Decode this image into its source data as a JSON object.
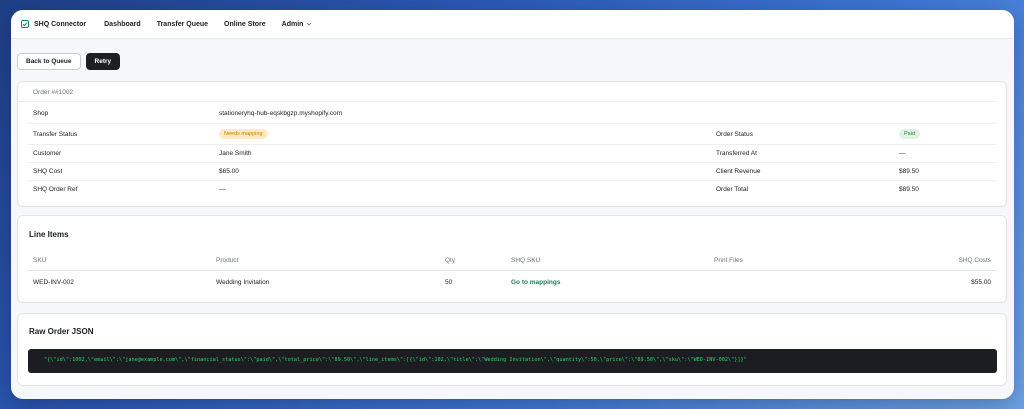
{
  "nav": {
    "brand": "SHQ Connector",
    "items": [
      "Dashboard",
      "Transfer Queue",
      "Online Store"
    ],
    "admin": "Admin"
  },
  "actions": {
    "back": "Back to Queue",
    "retry": "Retry"
  },
  "order": {
    "heading": "Order ##1002",
    "shop_label": "Shop",
    "shop_value": "stationeryhq-hub-eqskbgzp.myshopify.com",
    "transfer_status_label": "Transfer Status",
    "transfer_status_value": "Needs mapping",
    "order_status_label": "Order Status",
    "order_status_value": "Paid",
    "customer_label": "Customer",
    "customer_value": "Jane Smith",
    "transferred_at_label": "Transferred At",
    "transferred_at_value": "—",
    "shq_cost_label": "SHQ Cost",
    "shq_cost_value": "$65.00",
    "client_revenue_label": "Client Revenue",
    "client_revenue_value": "$89.50",
    "shq_order_ref_label": "SHQ Order Ref",
    "shq_order_ref_value": "—",
    "order_total_label": "Order Total",
    "order_total_value": "$89.50"
  },
  "line_items": {
    "title": "Line Items",
    "columns": [
      "SKU",
      "Product",
      "Qty",
      "SHQ SKU",
      "Print Files",
      "SHQ Costs"
    ],
    "rows": [
      {
        "sku": "WED-INV-002",
        "product": "Wedding Invitation",
        "qty": "50",
        "shq_sku": "Go to mappings",
        "print_files": "",
        "shq_costs": "$55.00"
      }
    ]
  },
  "raw": {
    "title": "Raw Order JSON",
    "json": "\"{\\\"id\\\":1002,\\\"email\\\":\\\"jane@example.com\\\",\\\"financial_status\\\":\\\"paid\\\",\\\"total_price\\\":\\\"89.50\\\",\\\"line_items\\\":[{\\\"id\\\":102,\\\"title\\\":\\\"Wedding Invitation\\\",\\\"quantity\\\":50,\\\"price\\\":\\\"89.50\\\",\\\"sku\\\":\\\"WED-INV-002\\\"}]}\""
  },
  "colors": {
    "primary_button": "#1f1f1f",
    "link": "#1f7a5c",
    "warning_badge": "#ffe8c2",
    "success_badge": "#dff3e4",
    "code_bg": "#1b1d22",
    "code_text": "#38d46a"
  }
}
